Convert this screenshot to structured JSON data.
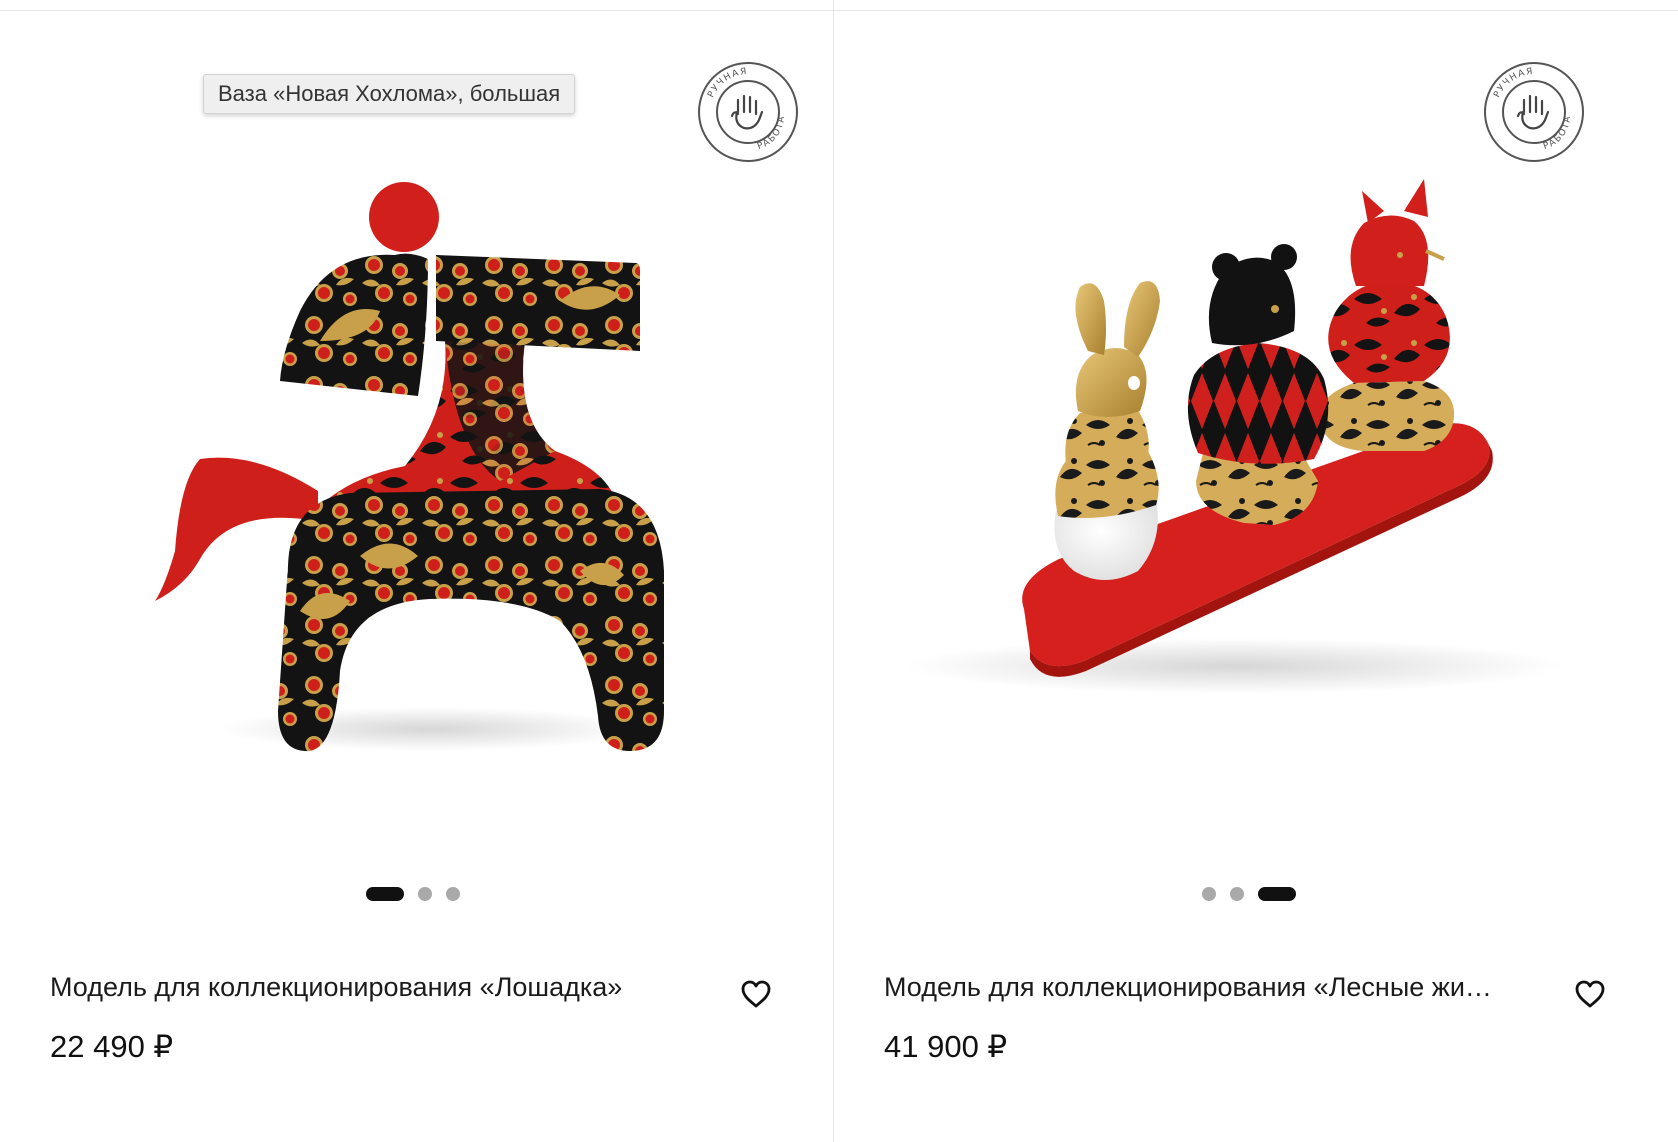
{
  "products": [
    {
      "title": "Модель для коллекционирования «Лошадка»",
      "price": "22 490 ₽",
      "badge": {
        "top": "РУЧНАЯ",
        "bottom": "РАБОТА",
        "icon": "hand-icon"
      },
      "carousel": {
        "count": 3,
        "active_index": 0
      },
      "favorite_icon": "heart-outline-icon"
    },
    {
      "title": "Модель для коллекционирования «Лесные жи…",
      "price": "41 900 ₽",
      "badge": {
        "top": "РУЧНАЯ",
        "bottom": "РАБОТА",
        "icon": "hand-icon"
      },
      "carousel": {
        "count": 3,
        "active_index": 2
      },
      "favorite_icon": "heart-outline-icon"
    }
  ],
  "tooltip": {
    "text": "Ваза «Новая Хохлома», большая"
  },
  "colors": {
    "khokhloma_red": "#d6201d",
    "khokhloma_black": "#131313",
    "khokhloma_gold": "#c9a04a",
    "text": "#1b1b1b"
  }
}
